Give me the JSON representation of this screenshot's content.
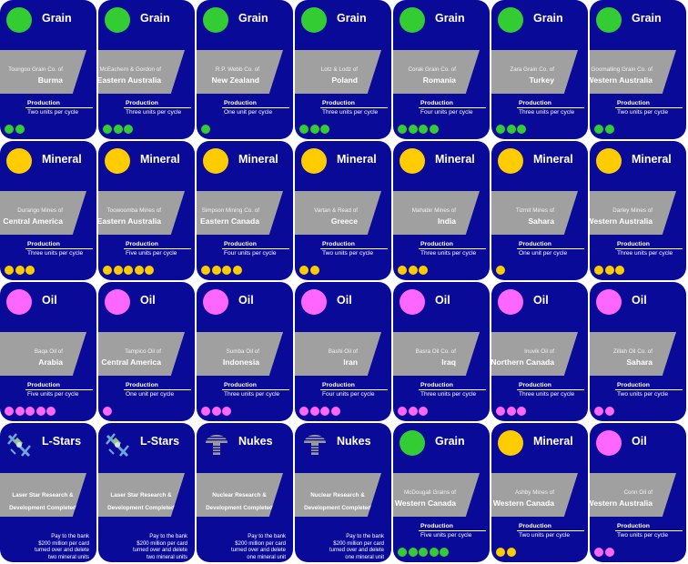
{
  "colors": {
    "card_bg": "#0a0a99",
    "band": "#a0a0a0",
    "grain": "#33cc33",
    "mineral": "#ffcc00",
    "oil": "#ff66ff"
  },
  "labels": {
    "production": "Production"
  },
  "cards": [
    {
      "kind": "resource",
      "resource": "grain",
      "category": "Grain",
      "company": "Toungoo Grain Co. of",
      "place": "Burma",
      "production": "Two units per cycle",
      "units": 2
    },
    {
      "kind": "resource",
      "resource": "grain",
      "category": "Grain",
      "company": "McEachern & Gordon of",
      "place": "Eastern Australia",
      "production": "Three units per cycle",
      "units": 3
    },
    {
      "kind": "resource",
      "resource": "grain",
      "category": "Grain",
      "company": "R.P. Webb Co. of",
      "place": "New Zealand",
      "production": "One unit per cycle",
      "units": 1
    },
    {
      "kind": "resource",
      "resource": "grain",
      "category": "Grain",
      "company": "Lotz & Lodz of",
      "place": "Poland",
      "production": "Three units per cycle",
      "units": 3
    },
    {
      "kind": "resource",
      "resource": "grain",
      "category": "Grain",
      "company": "Corak Grain Co. of",
      "place": "Romania",
      "production": "Four units per cycle",
      "units": 4
    },
    {
      "kind": "resource",
      "resource": "grain",
      "category": "Grain",
      "company": "Zara Grain Co. of",
      "place": "Turkey",
      "production": "Three units per cycle",
      "units": 3
    },
    {
      "kind": "resource",
      "resource": "grain",
      "category": "Grain",
      "company": "Goomalling Grain Co. of",
      "place": "Western Australia",
      "production": "Two units per cycle",
      "units": 2
    },
    {
      "kind": "resource",
      "resource": "mineral",
      "category": "Mineral",
      "company": "Durango Mines of",
      "place": "Central America",
      "production": "Three units per cycle",
      "units": 3
    },
    {
      "kind": "resource",
      "resource": "mineral",
      "category": "Mineral",
      "company": "Toowoomba Mines of",
      "place": "Eastern Australia",
      "production": "Five units per cycle",
      "units": 5
    },
    {
      "kind": "resource",
      "resource": "mineral",
      "category": "Mineral",
      "company": "Simpson Mining Co. of",
      "place": "Eastern Canada",
      "production": "Four units per cycle",
      "units": 4
    },
    {
      "kind": "resource",
      "resource": "mineral",
      "category": "Mineral",
      "company": "Vartan & Read of",
      "place": "Greece",
      "production": "Two units per cycle",
      "units": 2
    },
    {
      "kind": "resource",
      "resource": "mineral",
      "category": "Mineral",
      "company": "Mahabir Mines of",
      "place": "India",
      "production": "Three units per cycle",
      "units": 3
    },
    {
      "kind": "resource",
      "resource": "mineral",
      "category": "Mineral",
      "company": "Tizmit Mines of",
      "place": "Sahara",
      "production": "One unit per cycle",
      "units": 1
    },
    {
      "kind": "resource",
      "resource": "mineral",
      "category": "Mineral",
      "company": "Darley Mines of",
      "place": "Western Australia",
      "production": "Three units per cycle",
      "units": 3
    },
    {
      "kind": "resource",
      "resource": "oil",
      "category": "Oil",
      "company": "Baqa Oil of",
      "place": "Arabia",
      "production": "Five units per cycle",
      "units": 5
    },
    {
      "kind": "resource",
      "resource": "oil",
      "category": "Oil",
      "company": "Tampico Oil of",
      "place": "Central America",
      "production": "One unit per cycle",
      "units": 1
    },
    {
      "kind": "resource",
      "resource": "oil",
      "category": "Oil",
      "company": "Sumba Oil of",
      "place": "Indonesia",
      "production": "Three units per cycle",
      "units": 3
    },
    {
      "kind": "resource",
      "resource": "oil",
      "category": "Oil",
      "company": "Bashi Oil of",
      "place": "Iran",
      "production": "Four units per cycle",
      "units": 4
    },
    {
      "kind": "resource",
      "resource": "oil",
      "category": "Oil",
      "company": "Basra Oil Co. of",
      "place": "Iraq",
      "production": "Three units per cycle",
      "units": 3
    },
    {
      "kind": "resource",
      "resource": "oil",
      "category": "Oil",
      "company": "Inuvik Oil of",
      "place": "Northern Canada",
      "production": "Three units per cycle",
      "units": 3
    },
    {
      "kind": "resource",
      "resource": "oil",
      "category": "Oil",
      "company": "Zillah Oil Co. of",
      "place": "Sahara",
      "production": "Two units per cycle",
      "units": 2
    },
    {
      "kind": "research",
      "resource": "lstars",
      "category": "L-Stars",
      "title_lines": [
        "Laser Star Research &",
        "Development Completed"
      ],
      "pay_text": "Pay to the bank\n$200 million per card\nturned over and delete\ntwo mineral units"
    },
    {
      "kind": "research",
      "resource": "lstars",
      "category": "L-Stars",
      "title_lines": [
        "Laser Star Research &",
        "Development Completed"
      ],
      "pay_text": "Pay to the bank\n$200 million per card\nturned over and delete\ntwo mineral units"
    },
    {
      "kind": "research",
      "resource": "nukes",
      "category": "Nukes",
      "title_lines": [
        "Nuclear Research &",
        "Development Completed"
      ],
      "pay_text": "Pay to the bank\n$200 million per card\nturned over and delete\none mineral unit"
    },
    {
      "kind": "research",
      "resource": "nukes",
      "category": "Nukes",
      "title_lines": [
        "Nuclear Research &",
        "Development Completed"
      ],
      "pay_text": "Pay to the bank\n$200 million per card\nturned over and delete\none mineral unit"
    },
    {
      "kind": "resource",
      "resource": "grain",
      "category": "Grain",
      "company": "McDougall Grains of",
      "place": "Western Canada",
      "production": "Five units per cycle",
      "units": 5
    },
    {
      "kind": "resource",
      "resource": "mineral",
      "category": "Mineral",
      "company": "Ashby Mines of",
      "place": "Western Canada",
      "production": "Two units per cycle",
      "units": 2
    },
    {
      "kind": "resource",
      "resource": "oil",
      "category": "Oil",
      "company": "Conn Oil of",
      "place": "Western Australia",
      "production": "Two units per cycle",
      "units": 2
    }
  ]
}
